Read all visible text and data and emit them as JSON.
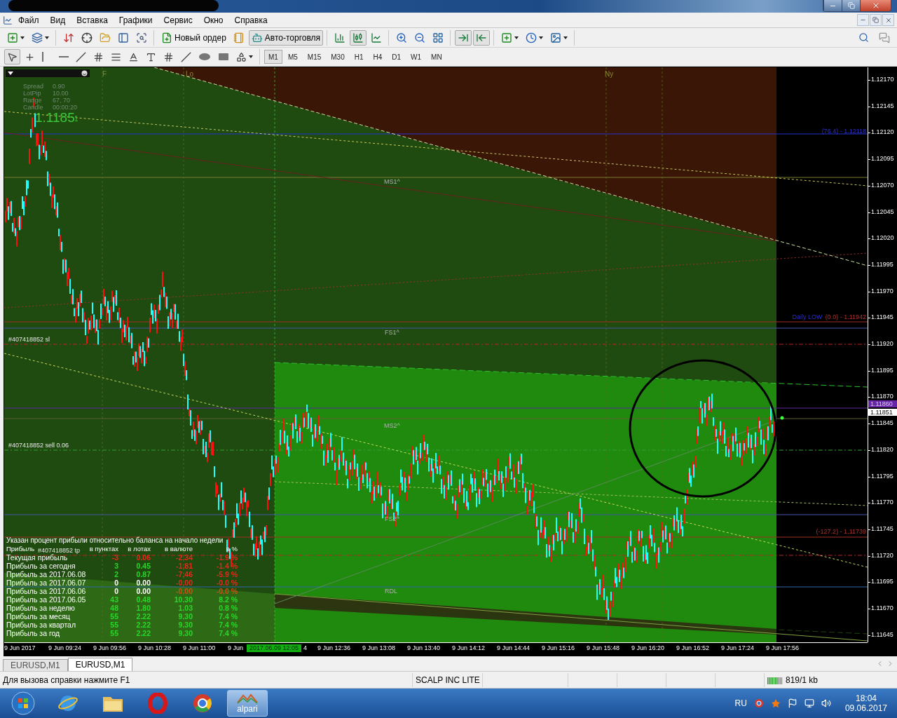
{
  "title_bar": {
    "redacted": true
  },
  "menu": [
    "Файл",
    "Вид",
    "Вставка",
    "Графики",
    "Сервис",
    "Окно",
    "Справка"
  ],
  "main_toolbar": [
    {
      "pressed": false
    },
    {
      "pressed": false
    },
    {
      "pressed": false
    },
    {
      "pressed": false
    },
    {
      "pressed": false
    },
    {
      "pressed": false
    },
    {
      "pressed": false
    },
    {
      "label": "Новый ордер",
      "pressed": false
    },
    {
      "pressed": false
    },
    {
      "label": "Авто-торговля",
      "pressed": true
    },
    {
      "pressed": false
    },
    {
      "pressed": true
    },
    {
      "pressed": false
    },
    {
      "pressed": false
    },
    {
      "pressed": false
    },
    {
      "pressed": false
    },
    {
      "pressed": true
    },
    {
      "pressed": true
    },
    {
      "pressed": false
    },
    {
      "pressed": false
    },
    {
      "pressed": false
    }
  ],
  "drawing_toolbar": [
    {
      "pressed": true
    },
    {
      "pressed": false
    },
    {
      "pressed": false
    },
    {
      "pressed": false
    },
    {
      "pressed": false
    },
    {
      "pressed": false
    },
    {
      "pressed": false
    },
    {
      "pressed": false
    },
    {
      "pressed": false
    },
    {
      "pressed": false
    },
    {
      "pressed": false
    },
    {
      "pressed": false
    },
    {
      "pressed": false
    },
    {
      "pressed": false
    }
  ],
  "timeframes": [
    {
      "label": "M1",
      "selected": true
    },
    {
      "label": "M5",
      "selected": false
    },
    {
      "label": "M15",
      "selected": false
    },
    {
      "label": "M30",
      "selected": false
    },
    {
      "label": "H1",
      "selected": false
    },
    {
      "label": "H4",
      "selected": false
    },
    {
      "label": "D1",
      "selected": false
    },
    {
      "label": "W1",
      "selected": false
    },
    {
      "label": "MN",
      "selected": false
    }
  ],
  "chart": {
    "info_panel": {
      "rows": [
        {
          "label": "Spread",
          "value": "0.90"
        },
        {
          "label": "LotPip",
          "value": "10.00"
        },
        {
          "label": "Range",
          "value": "67, 70"
        },
        {
          "label": "Candle",
          "value": "00:00:20"
        }
      ],
      "price": "1.1185",
      "price_tail": "1"
    },
    "session_labels": [
      "F",
      "Lo",
      "Ny"
    ],
    "level_labels": [
      "MS1^",
      "FS1^",
      "MS2^",
      "FS2^",
      "RDL"
    ],
    "order_labels": [
      "#407418852 sl",
      "#407418852 sell 0.06",
      "#407418852 tp"
    ],
    "fibo_labels": [
      {
        "text": "(76.4) -  1.12118"
      },
      {
        "name": "Daily LOW",
        "text": "(0.0) -  1.11942"
      },
      {
        "text": "(-127.2) -  1.11739"
      }
    ],
    "profit_table": {
      "note": "Указан процент прибыли относительно баланса на начало недели",
      "label_header": "Прибыль",
      "columns": [
        "в пунктах",
        "в лотах",
        "в валюте",
        "в %"
      ],
      "rows": [
        {
          "label": "Текущая прибыль",
          "cells": [
            {
              "text": "-3",
              "color": "#e8281c"
            },
            {
              "text": "0.06",
              "color": "#e8281c"
            },
            {
              "text": "-2.34",
              "color": "#e8281c"
            },
            {
              "text": "-1.9 %",
              "color": "#e8281c"
            }
          ]
        },
        {
          "label": "Прибыль за сегодня",
          "cells": [
            {
              "text": "3",
              "color": "#28d828"
            },
            {
              "text": "0.45",
              "color": "#28d828"
            },
            {
              "text": "-1.81",
              "color": "#e8281c"
            },
            {
              "text": "-1.4 %",
              "color": "#e8281c"
            }
          ]
        },
        {
          "label": "Прибыль за 2017.06.08",
          "cells": [
            {
              "text": "2",
              "color": "#28d828"
            },
            {
              "text": "0.87",
              "color": "#28d828"
            },
            {
              "text": "-7.46",
              "color": "#e8281c"
            },
            {
              "text": "-5.9 %",
              "color": "#e8281c"
            }
          ]
        },
        {
          "label": "Прибыль за 2017.06.07",
          "cells": [
            {
              "text": "0",
              "color": "#ffffff"
            },
            {
              "text": "0.00",
              "color": "#ffffff"
            },
            {
              "text": "-0.00",
              "color": "#e8281c"
            },
            {
              "text": "-0.0 %",
              "color": "#e8281c"
            }
          ]
        },
        {
          "label": "Прибыль за 2017.06.06",
          "cells": [
            {
              "text": "0",
              "color": "#ffffff"
            },
            {
              "text": "0.00",
              "color": "#ffffff"
            },
            {
              "text": "-0.00",
              "color": "#d05010"
            },
            {
              "text": "-0.0 %",
              "color": "#d05010"
            }
          ]
        },
        {
          "label": "Прибыль за 2017.06.05",
          "cells": [
            {
              "text": "43",
              "color": "#28d828"
            },
            {
              "text": "0.48",
              "color": "#28d828"
            },
            {
              "text": "10.30",
              "color": "#28d828"
            },
            {
              "text": "8.2 %",
              "color": "#28d828"
            }
          ]
        },
        {
          "label": "Прибыль за неделю",
          "cells": [
            {
              "text": "48",
              "color": "#28d828"
            },
            {
              "text": "1.80",
              "color": "#28d828"
            },
            {
              "text": "1.03",
              "color": "#28d828"
            },
            {
              "text": "0.8 %",
              "color": "#28d828"
            }
          ]
        },
        {
          "label": "Прибыль за месяц",
          "cells": [
            {
              "text": "55",
              "color": "#28d828"
            },
            {
              "text": "2.22",
              "color": "#28d828"
            },
            {
              "text": "9.30",
              "color": "#28d828"
            },
            {
              "text": "7.4 %",
              "color": "#28d828"
            }
          ]
        },
        {
          "label": "Прибыль за квартал",
          "cells": [
            {
              "text": "55",
              "color": "#28d828"
            },
            {
              "text": "2.22",
              "color": "#28d828"
            },
            {
              "text": "9.30",
              "color": "#28d828"
            },
            {
              "text": "7.4 %",
              "color": "#28d828"
            }
          ]
        },
        {
          "label": "Прибыль за год",
          "cells": [
            {
              "text": "55",
              "color": "#28d828"
            },
            {
              "text": "2.22",
              "color": "#28d828"
            },
            {
              "text": "9.30",
              "color": "#28d828"
            },
            {
              "text": "7.4 %",
              "color": "#28d828"
            }
          ]
        }
      ]
    },
    "price_axis": [
      "1.12170",
      "1.12145",
      "1.12120",
      "1.12095",
      "1.12070",
      "1.12045",
      "1.12020",
      "1.11995",
      "1.11970",
      "1.11945",
      "1.11920",
      "1.11895",
      "1.11870",
      "1.11845",
      "1.11820",
      "1.11795",
      "1.11770",
      "1.11745",
      "1.11720",
      "1.11695",
      "1.11670",
      "1.11645"
    ],
    "price_markers": [
      {
        "text": "1.11860",
        "kind": "line"
      },
      {
        "text": "1.11851",
        "kind": "bid"
      }
    ],
    "time_axis": [
      {
        "text": "9 Jun 2017",
        "kind": "tick"
      },
      {
        "text": "9 Jun 09:24",
        "kind": "tick"
      },
      {
        "text": "9 Jun 09:56",
        "kind": "tick"
      },
      {
        "text": "9 Jun 10:28",
        "kind": "tick"
      },
      {
        "text": "9 Jun 11:00",
        "kind": "tick"
      },
      {
        "text": "9 Jun",
        "kind": "tick"
      },
      {
        "text": "4",
        "kind": "clipped"
      },
      {
        "text": "9 Jun 12:36",
        "kind": "tick"
      },
      {
        "text": "9 Jun 13:08",
        "kind": "tick"
      },
      {
        "text": "9 Jun 13:40",
        "kind": "tick"
      },
      {
        "text": "9 Jun 14:12",
        "kind": "tick"
      },
      {
        "text": "9 Jun 14:44",
        "kind": "tick"
      },
      {
        "text": "9 Jun 15:16",
        "kind": "tick"
      },
      {
        "text": "9 Jun 15:48",
        "kind": "tick"
      },
      {
        "text": "9 Jun 16:20",
        "kind": "tick"
      },
      {
        "text": "9 Jun 16:52",
        "kind": "tick"
      },
      {
        "text": "9 Jun 17:24",
        "kind": "tick"
      },
      {
        "text": "9 Jun 17:56",
        "kind": "tick"
      }
    ],
    "cursor_time": "2017.06.09 12:05"
  },
  "chart_tabs": [
    {
      "label": "EURUSD,M1",
      "selected": false
    },
    {
      "label": "EURUSD,M1",
      "selected": true
    }
  ],
  "status_bar": {
    "help": "Для вызова справки нажмите F1",
    "profile": "SCALP INC LITE",
    "traffic": "819/1 kb"
  },
  "taskbar": {
    "apps": [
      {
        "kind": "globe",
        "active": false
      },
      {
        "kind": "folder",
        "active": false
      },
      {
        "kind": "ring",
        "active": false
      },
      {
        "kind": "wheel",
        "active": false
      },
      {
        "kind": "app",
        "label": "alpari",
        "active": true
      }
    ],
    "language": "RU",
    "time": "18:04",
    "date": "09.06.2017"
  }
}
